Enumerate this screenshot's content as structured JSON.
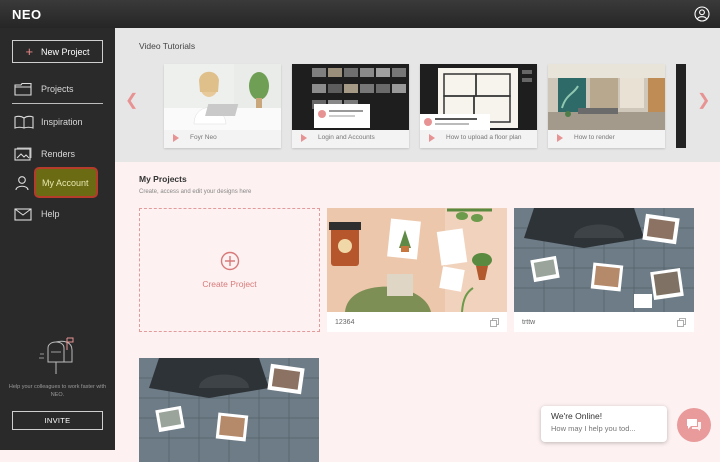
{
  "app": {
    "brand": "NEO"
  },
  "sidebar": {
    "new_project_label": "New Project",
    "items": [
      {
        "label": "Projects",
        "icon": "folder-icon"
      },
      {
        "label": "Inspiration",
        "icon": "book-icon"
      },
      {
        "label": "Renders",
        "icon": "image-icon"
      },
      {
        "label": "My Account",
        "icon": "user-icon"
      },
      {
        "label": "Help",
        "icon": "mail-icon"
      }
    ],
    "help_text": "Help your colleagues to work faster with NEO.",
    "invite_label": "INVITE"
  },
  "tutorials": {
    "title": "Video Tutorials",
    "items": [
      {
        "title": "Foyr Neo"
      },
      {
        "title": "Login and Accounts"
      },
      {
        "title": "How to upload a floor plan"
      },
      {
        "title": "How to render"
      }
    ]
  },
  "projects": {
    "title": "My Projects",
    "subtitle": "Create, access and edit your designs here",
    "create_label": "Create Project",
    "items": [
      {
        "name": "12364"
      },
      {
        "name": "trttw"
      },
      {
        "name": ""
      }
    ]
  },
  "chat": {
    "line1": "We're Online!",
    "line2": "How may I help you tod..."
  },
  "colors": {
    "accent": "#e89393",
    "sidebar": "#2a2a2a",
    "highlight": "#6b6b14",
    "highlight_border": "#b53b2b"
  }
}
